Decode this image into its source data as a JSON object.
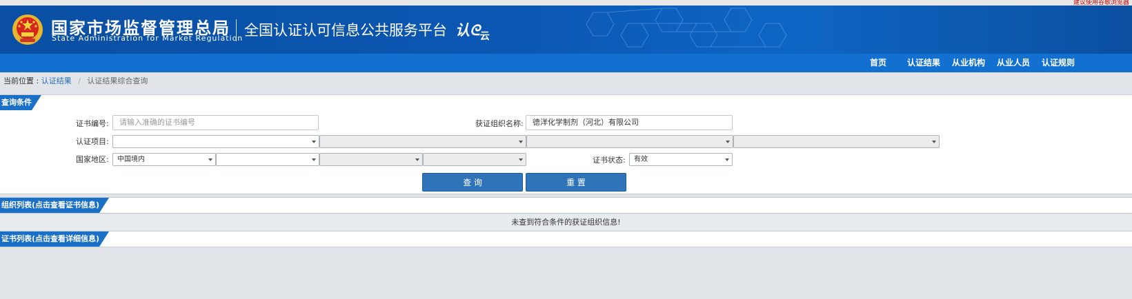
{
  "top_notice": "建议使用谷歌浏览器",
  "header": {
    "agency_cn": "国家市场监督管理总局",
    "agency_en": "State Administration  for  Market Regulation",
    "platform": "全国认证认可信息公共服务平台",
    "logo_text": "认",
    "logo_small": "云"
  },
  "nav": {
    "items": [
      "首页",
      "认证结果",
      "从业机构",
      "从业人员",
      "认证规则"
    ]
  },
  "breadcrumb": {
    "prefix": "当前位置 :",
    "link": "认证结果",
    "separator": "/",
    "current": "认证结果综合查询"
  },
  "sections": {
    "query": "查询条件",
    "org_list": "组织列表(点击查看证书信息)",
    "cert_list": "证书列表(点击查看详细信息)"
  },
  "form": {
    "cert_no_label": "证书编号:",
    "cert_no_placeholder": "请输入准确的证书编号",
    "org_name_label": "获证组织名称:",
    "org_name_value": "德洋化学制剂（河北）有限公司",
    "project_label": "认证项目:",
    "project_selects": [
      "",
      "",
      "",
      ""
    ],
    "region_label": "国家地区:",
    "region_selects": [
      "中国境内",
      "",
      "",
      ""
    ],
    "status_label": "证书状态:",
    "status_value": "有效",
    "search_button": "查  询",
    "reset_button": "重  置"
  },
  "message": "未查到符合条件的获证组织信息!",
  "colors": {
    "header_blue": "#0b57b3",
    "nav_blue": "#1270d0",
    "tab_blue": "#1a6fc7",
    "button_blue": "#2f74b8",
    "page_bg": "#e1e5ea"
  }
}
